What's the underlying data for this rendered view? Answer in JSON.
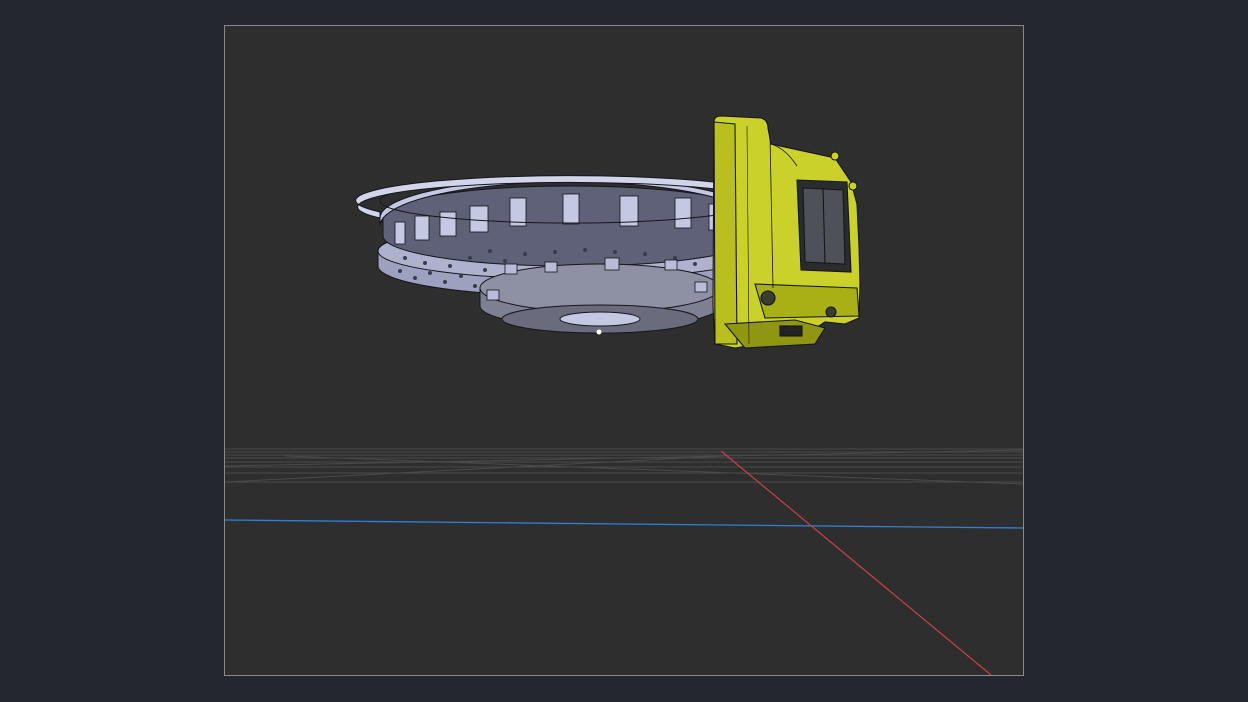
{
  "viewport": {
    "background": "#2e2e2e",
    "frame_color": "#8a8a8a"
  },
  "scene": {
    "grid_color": "#4a4a4a",
    "x_axis_color": "#c8424c",
    "y_axis_color": "#2f7fd6",
    "model": {
      "disc_color": "#b8bcd8",
      "disc_shadow": "#6f7390",
      "hub_color": "#7d7f92",
      "caliper_color": "#c9d12a",
      "caliper_shadow": "#8e9612",
      "outline_color": "#15161c"
    }
  }
}
